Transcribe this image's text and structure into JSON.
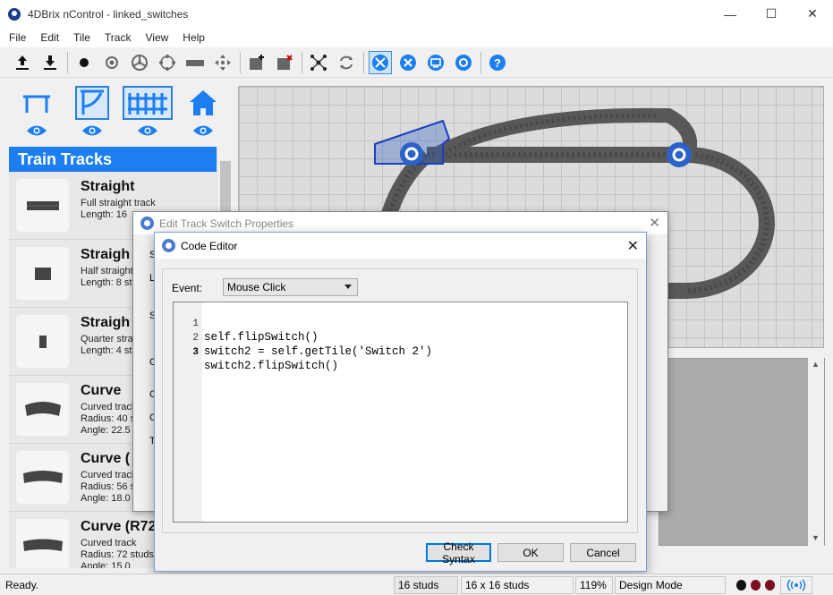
{
  "window": {
    "title": "4DBrix nControl - linked_switches",
    "minimize": "—",
    "maximize": "☐",
    "close": "✕"
  },
  "menu": [
    "File",
    "Edit",
    "Tile",
    "Track",
    "View",
    "Help"
  ],
  "toolbar": {
    "groups": [
      [
        "upload-icon",
        "download-icon"
      ],
      [
        "dot-icon",
        "target-icon",
        "wheel-icon",
        "circle-dots-icon",
        "rail-icon",
        "move-icon"
      ],
      [
        "add-tile-icon",
        "delete-tile-icon"
      ],
      [
        "network-icon",
        "cycle-icon"
      ],
      [
        "design-tools-icon",
        "tools-icon",
        "monitor-icon",
        "settings-icon"
      ],
      [
        "help-icon"
      ]
    ],
    "active": "design-tools-icon",
    "accent": "#1c7ef0"
  },
  "palette": {
    "categories": [
      "tracks",
      "structures",
      "fences",
      "buildings"
    ],
    "selected": "fences",
    "header": "Train Tracks",
    "items": [
      {
        "name": "Straight",
        "desc1": "Full straight track",
        "desc2": "Length: 16"
      },
      {
        "name": "Straigh",
        "desc1": "Half straight",
        "desc2": "Length: 8 st"
      },
      {
        "name": "Straigh",
        "desc1": "Quarter stra",
        "desc2": "Length: 4 st"
      },
      {
        "name": "Curve",
        "desc1": "Curved track",
        "desc2": "Radius: 40 s",
        "desc3": "Angle: 22.5"
      },
      {
        "name": "Curve (",
        "desc1": "Curved track",
        "desc2": "Radius: 56 s",
        "desc3": "Angle: 18.0"
      },
      {
        "name": "Curve (R72",
        "desc1": "Curved track",
        "desc2": "Radius: 72 studs",
        "desc3": "Angle: 15.0"
      }
    ]
  },
  "back_dialog": {
    "title": "Edit Track Switch Properties",
    "labels": [
      "S",
      "L",
      "S",
      "C",
      "C",
      "C",
      "T"
    ]
  },
  "code_editor": {
    "title": "Code Editor",
    "event_label": "Event:",
    "event_value": "Mouse Click",
    "lines": [
      {
        "n": "1",
        "code": "self.flipSwitch()"
      },
      {
        "n": "2",
        "code": "switch2 = self.getTile('Switch 2')"
      },
      {
        "n": "3",
        "code": "switch2.flipSwitch()"
      }
    ],
    "buttons": {
      "check": "Check Syntax",
      "ok": "OK",
      "cancel": "Cancel"
    }
  },
  "status": {
    "ready": "Ready.",
    "grid_size": "16 studs",
    "tile_size": "16 x 16 studs",
    "zoom": "119%",
    "mode": "Design Mode",
    "leds": [
      "#111111",
      "#7a1020",
      "#7a1020"
    ]
  }
}
